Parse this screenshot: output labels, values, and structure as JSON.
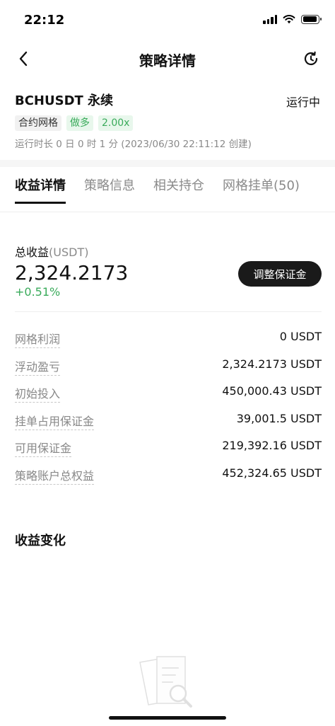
{
  "status_bar": {
    "time": "22:12"
  },
  "nav": {
    "title": "策略详情"
  },
  "header": {
    "symbol": "BCHUSDT 永续",
    "status": "运行中",
    "tags": [
      "合约网格",
      "做多",
      "2.00x"
    ],
    "run_time": "运行时长 0 日 0 时 1 分 (2023/06/30 22:11:12 创建)"
  },
  "tabs": [
    "收益详情",
    "策略信息",
    "相关持仓",
    "网格挂单(50)"
  ],
  "summary": {
    "label": "总收益",
    "unit": "(USDT)",
    "value": "2,324.2173",
    "percent": "+0.51%",
    "adjust_button": "调整保证金"
  },
  "details": [
    {
      "label": "网格利润",
      "value": "0 USDT"
    },
    {
      "label": "浮动盈亏",
      "value": "2,324.2173 USDT"
    },
    {
      "label": "初始投入",
      "value": "450,000.43 USDT"
    },
    {
      "label": "挂单占用保证金",
      "value": "39,001.5 USDT"
    },
    {
      "label": "可用保证金",
      "value": "219,392.16 USDT"
    },
    {
      "label": "策略账户总权益",
      "value": "452,324.65 USDT"
    }
  ],
  "income_change": {
    "title": "收益变化"
  },
  "colors": {
    "accent_green": "#3aab5b",
    "button_dark": "#1a1a1a",
    "muted_gray": "#8a8a8a"
  },
  "icons": [
    "signal-icon",
    "wifi-icon",
    "battery-icon",
    "back-arrow-icon",
    "refresh-icon",
    "empty-data-icon"
  ]
}
